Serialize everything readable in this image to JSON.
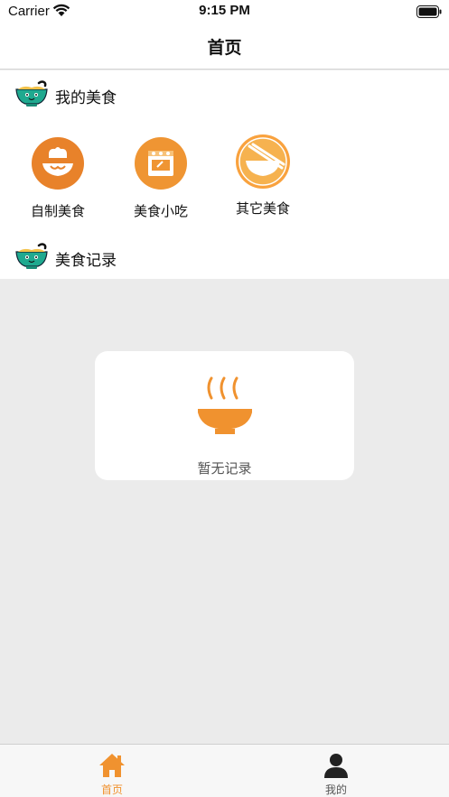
{
  "status_bar": {
    "carrier": "Carrier",
    "time": "9:15 PM"
  },
  "nav": {
    "title": "首页"
  },
  "sections": {
    "my_food": {
      "title": "我的美食"
    },
    "records": {
      "title": "美食记录"
    }
  },
  "categories": [
    {
      "label": "自制美食",
      "icon": "chef-hat-icon",
      "color": "#e8822a"
    },
    {
      "label": "美食小吃",
      "icon": "food-stall-icon",
      "color": "#ef9533"
    },
    {
      "label": "其它美食",
      "icon": "bowl-chopsticks-icon",
      "color": "#f9a23e"
    }
  ],
  "empty_state": {
    "text": "暂无记录",
    "icon": "steaming-bowl-icon"
  },
  "tabs": [
    {
      "label": "首页",
      "icon": "home-icon",
      "active": true
    },
    {
      "label": "我的",
      "icon": "person-icon",
      "active": false
    }
  ],
  "colors": {
    "accent": "#f0922f",
    "bowl_teal": "#1fa98f",
    "background": "#ebebeb"
  }
}
